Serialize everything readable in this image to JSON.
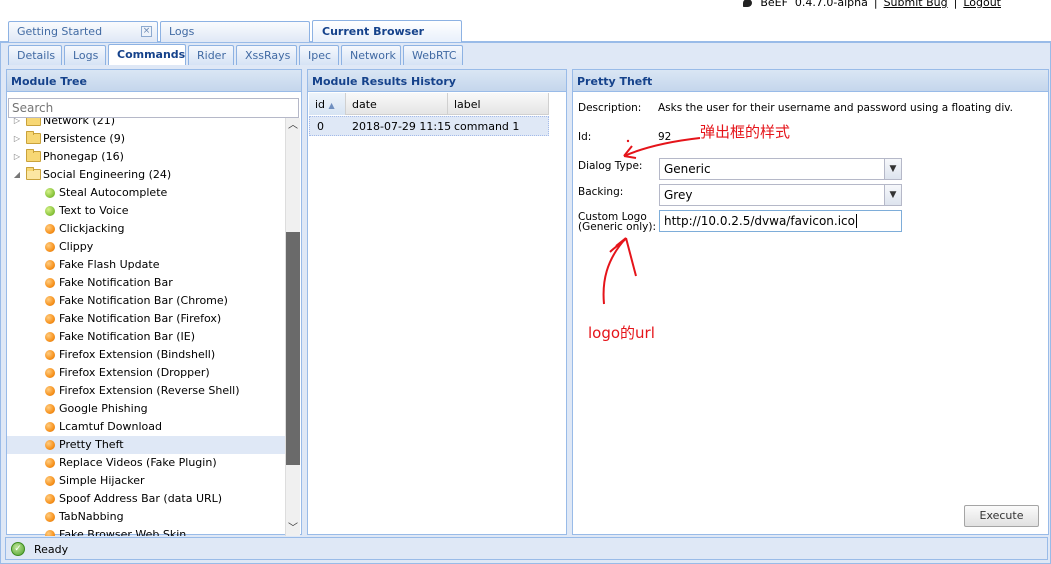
{
  "header": {
    "app_name": "BeEF",
    "version": "0.4.7.0-alpha",
    "links": [
      "Submit Bug",
      "Logout"
    ]
  },
  "outer_tabs": [
    {
      "label": "Getting Started",
      "closable": true,
      "active": false
    },
    {
      "label": "Logs",
      "closable": false,
      "active": false
    },
    {
      "label": "Current Browser",
      "closable": false,
      "active": true
    }
  ],
  "inner_tabs": [
    {
      "label": "Details",
      "active": false
    },
    {
      "label": "Logs",
      "active": false
    },
    {
      "label": "Commands",
      "active": true
    },
    {
      "label": "Rider",
      "active": false
    },
    {
      "label": "XssRays",
      "active": false
    },
    {
      "label": "Ipec",
      "active": false
    },
    {
      "label": "Network",
      "active": false
    },
    {
      "label": "WebRTC",
      "active": false
    }
  ],
  "module_tree": {
    "title": "Module Tree",
    "search_placeholder": "Search",
    "items": [
      {
        "type": "folder",
        "label": "Network (21)",
        "expanded": false
      },
      {
        "type": "folder",
        "label": "Persistence (9)",
        "expanded": false
      },
      {
        "type": "folder",
        "label": "Phonegap (16)",
        "expanded": false
      },
      {
        "type": "folder",
        "label": "Social Engineering (24)",
        "expanded": true
      },
      {
        "type": "module",
        "label": "Steal Autocomplete",
        "status": "green"
      },
      {
        "type": "module",
        "label": "Text to Voice",
        "status": "green"
      },
      {
        "type": "module",
        "label": "Clickjacking",
        "status": "orange"
      },
      {
        "type": "module",
        "label": "Clippy",
        "status": "orange"
      },
      {
        "type": "module",
        "label": "Fake Flash Update",
        "status": "orange"
      },
      {
        "type": "module",
        "label": "Fake Notification Bar",
        "status": "orange"
      },
      {
        "type": "module",
        "label": "Fake Notification Bar (Chrome)",
        "status": "orange"
      },
      {
        "type": "module",
        "label": "Fake Notification Bar (Firefox)",
        "status": "orange"
      },
      {
        "type": "module",
        "label": "Fake Notification Bar (IE)",
        "status": "orange"
      },
      {
        "type": "module",
        "label": "Firefox Extension (Bindshell)",
        "status": "orange"
      },
      {
        "type": "module",
        "label": "Firefox Extension (Dropper)",
        "status": "orange"
      },
      {
        "type": "module",
        "label": "Firefox Extension (Reverse Shell)",
        "status": "orange"
      },
      {
        "type": "module",
        "label": "Google Phishing",
        "status": "orange"
      },
      {
        "type": "module",
        "label": "Lcamtuf Download",
        "status": "orange"
      },
      {
        "type": "module",
        "label": "Pretty Theft",
        "status": "orange",
        "selected": true
      },
      {
        "type": "module",
        "label": "Replace Videos (Fake Plugin)",
        "status": "orange"
      },
      {
        "type": "module",
        "label": "Simple Hijacker",
        "status": "orange"
      },
      {
        "type": "module",
        "label": "Spoof Address Bar (data URL)",
        "status": "orange"
      },
      {
        "type": "module",
        "label": "TabNabbing",
        "status": "orange"
      },
      {
        "type": "module",
        "label": "Fake Browser Web Skin...",
        "status": "orange"
      }
    ]
  },
  "results": {
    "title": "Module Results History",
    "columns": [
      "id",
      "date",
      "label"
    ],
    "sorted_column": "id",
    "rows": [
      {
        "id": "0",
        "date": "2018-07-29 11:15",
        "label": "command 1"
      }
    ]
  },
  "details": {
    "title": "Pretty Theft",
    "description_label": "Description:",
    "description": "Asks the user for their username and password using a floating div.",
    "id_label": "Id:",
    "id": "92",
    "dialog_type_label": "Dialog Type:",
    "dialog_type": "Generic",
    "backing_label": "Backing:",
    "backing": "Grey",
    "custom_logo_label": "Custom Logo",
    "custom_logo_sublabel": "(Generic only):",
    "custom_logo": "http://10.0.2.5/dvwa/favicon.ico",
    "execute_label": "Execute"
  },
  "annotations": {
    "dialog_style": "弹出框的样式",
    "logo_url": "logo的url",
    "color": "#e5141a"
  },
  "status": {
    "text": "Ready"
  }
}
